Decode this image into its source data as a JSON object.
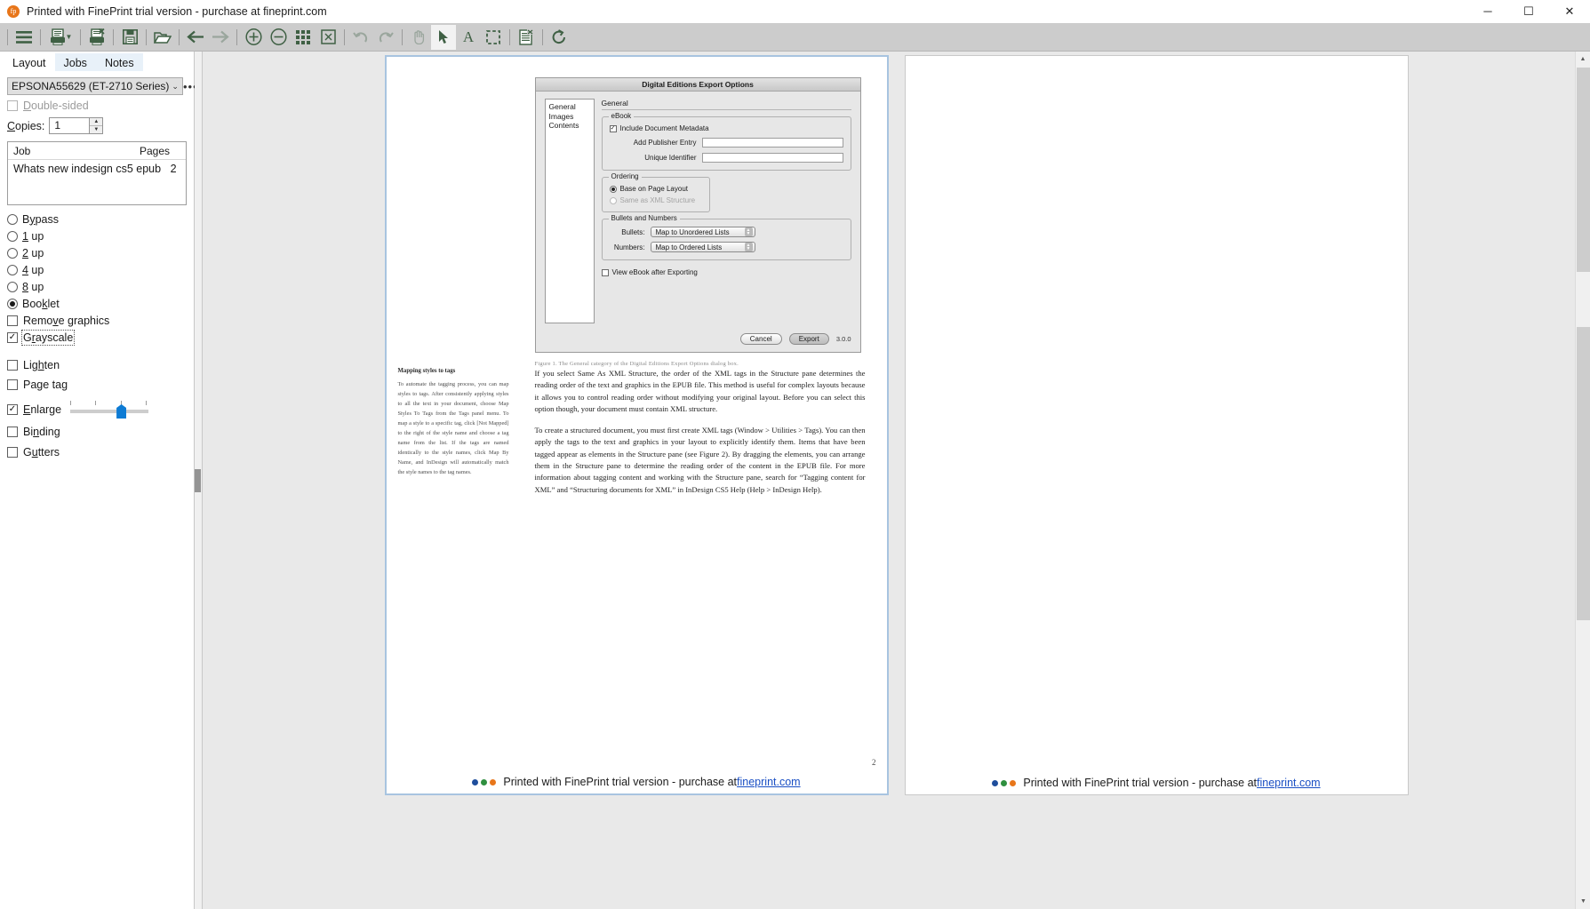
{
  "window": {
    "title": "Printed with FinePrint trial version - purchase at fineprint.com",
    "logo_text": "fp",
    "minimize": "─",
    "maximize": "☐",
    "close": "✕"
  },
  "toolbar": {
    "items": [
      {
        "name": "menu-icon",
        "glyph": "☰"
      },
      {
        "name": "print-icon",
        "glyph": "⎙"
      },
      {
        "name": "print-dropdown-caret-icon",
        "glyph": "▼"
      },
      {
        "name": "delete-job-icon",
        "glyph": "⎘"
      },
      {
        "name": "save-icon",
        "glyph": "💾"
      },
      {
        "name": "open-folder-icon",
        "glyph": "🗁"
      },
      {
        "name": "back-arrow-icon",
        "glyph": "←"
      },
      {
        "name": "forward-arrow-icon",
        "glyph": "→"
      },
      {
        "name": "zoom-in-icon",
        "glyph": "⊕"
      },
      {
        "name": "zoom-out-icon",
        "glyph": "⊖"
      },
      {
        "name": "thumbnails-grid-icon",
        "glyph": "∷"
      },
      {
        "name": "fit-page-icon",
        "glyph": "⛶"
      },
      {
        "name": "undo-icon",
        "glyph": "↶"
      },
      {
        "name": "redo-icon",
        "glyph": "↷"
      },
      {
        "name": "hand-tool-icon",
        "glyph": "✋"
      },
      {
        "name": "select-tool-icon",
        "glyph": "➤"
      },
      {
        "name": "text-tool-icon",
        "glyph": "A"
      },
      {
        "name": "marquee-tool-icon",
        "glyph": "⬚"
      },
      {
        "name": "page-properties-icon",
        "glyph": "☷"
      },
      {
        "name": "refresh-icon",
        "glyph": "⟳"
      }
    ]
  },
  "left_panel": {
    "tabs": [
      {
        "label": "Layout",
        "selected": true
      },
      {
        "label": "Jobs",
        "selected": false
      },
      {
        "label": "Notes",
        "selected": false
      }
    ],
    "printer": {
      "value": "EPSONA55629 (ET-2710 Series)",
      "more_button": "•••",
      "chevron": "⌄"
    },
    "double_sided": {
      "label": "Double-sided",
      "accel": "D",
      "checked": false,
      "enabled": false
    },
    "copies": {
      "label": "Copies:",
      "accel": "C",
      "value": "1"
    },
    "job_table": {
      "columns": [
        "Job",
        "Pages"
      ],
      "rows": [
        {
          "job": "Whats new indesign cs5 epub",
          "pages": "2"
        }
      ]
    },
    "layout_options": [
      {
        "type": "radio",
        "label": "Bypass",
        "accel": "y",
        "checked": false
      },
      {
        "type": "radio",
        "label": "1 up",
        "accel": "1",
        "checked": false
      },
      {
        "type": "radio",
        "label": "2 up",
        "accel": "2",
        "checked": false
      },
      {
        "type": "radio",
        "label": "4 up",
        "accel": "4",
        "checked": false
      },
      {
        "type": "radio",
        "label": "8 up",
        "accel": "8",
        "checked": false
      },
      {
        "type": "radio",
        "label": "Booklet",
        "accel": "k",
        "checked": true
      },
      {
        "type": "check",
        "label": "Remove graphics",
        "accel": "v",
        "checked": false
      },
      {
        "type": "check",
        "label": "Grayscale",
        "accel": "r",
        "checked": true,
        "focused": true
      }
    ],
    "more_options": [
      {
        "type": "check",
        "label": "Lighten",
        "accel": "h",
        "checked": false,
        "slider": false
      },
      {
        "type": "check",
        "label": "Page tag",
        "accel": "g",
        "checked": false,
        "slider": false
      },
      {
        "type": "check",
        "label": "Enlarge",
        "accel": "E",
        "checked": true,
        "slider": true
      },
      {
        "type": "check",
        "label": "Binding",
        "accel": "n",
        "checked": false,
        "slider": false
      },
      {
        "type": "check",
        "label": "Gutters",
        "accel": "u",
        "checked": false,
        "slider": false
      }
    ]
  },
  "preview": {
    "page_number": "2",
    "footer": {
      "text_before": "Printed with FinePrint trial version - purchase at ",
      "link": "fineprint.com"
    },
    "document": {
      "dialog": {
        "title": "Digital Editions Export Options",
        "nav_items": [
          "General",
          "Images",
          "Contents"
        ],
        "section_title": "General",
        "ebook_group": {
          "label": "eBook",
          "include_metadata": {
            "label": "Include Document Metadata",
            "checked": true
          },
          "fields": [
            {
              "label": "Add Publisher Entry",
              "value": ""
            },
            {
              "label": "Unique Identifier",
              "value": ""
            }
          ]
        },
        "ordering_group": {
          "label": "Ordering",
          "options": [
            {
              "label": "Base on Page Layout",
              "checked": true,
              "enabled": true
            },
            {
              "label": "Same as XML Structure",
              "checked": false,
              "enabled": false
            }
          ]
        },
        "bullets_group": {
          "label": "Bullets and Numbers",
          "rows": [
            {
              "label": "Bullets:",
              "value": "Map to Unordered Lists"
            },
            {
              "label": "Numbers:",
              "value": "Map to Ordered Lists"
            }
          ]
        },
        "view_after_export": {
          "label": "View eBook after Exporting",
          "checked": false
        },
        "buttons": [
          {
            "label": "Cancel",
            "default": false
          },
          {
            "label": "Export",
            "default": true
          }
        ],
        "version": "3.0.0"
      },
      "figure_caption": "Figure 1. The General category of the Digital Editions Export Options dialog box.",
      "sidebar_heading": "Mapping styles to tags",
      "sidebar_body": "To automate the tagging process, you can map styles to tags. After consistently applying styles to all the text in your document, choose Map Styles To Tags from the Tags panel menu. To map a style to a specific tag, click [Not Mapped] to the right of the style name and choose a tag name from the list. If the tags are named identically to the style names, click Map By Name, and InDesign will automatically match the style names to the tag names.",
      "paragraphs": [
        "If you select Same As XML Structure, the order of the XML tags in the Structure pane determines the reading order of the text and graphics in the EPUB file. This method is useful for complex layouts because it allows you to control reading order without modifying your original layout. Before you can select this option though, your document must contain XML structure.",
        "To create a structured document, you must first create XML tags (Window > Utilities > Tags). You can then apply the tags to the text and graphics in your layout to explicitly identify them. Items that have been tagged appear as elements in the Structure pane (see Figure 2). By dragging the elements, you can arrange them in the Structure pane to determine the reading order of the content in the EPUB file. For more information about tagging content and working with the Structure pane, search for “Tagging content for XML” and “Structuring documents for XML” in InDesign CS5 Help (Help > InDesign Help)."
      ]
    }
  },
  "scrollbar": {
    "up_arrow": "▲",
    "down_arrow": "▼"
  }
}
